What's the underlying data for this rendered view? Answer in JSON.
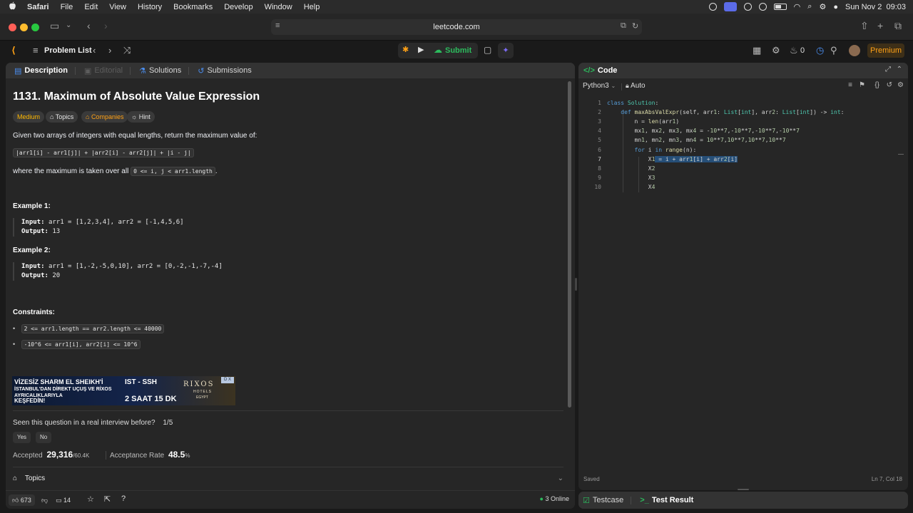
{
  "menubar": {
    "app": "Safari",
    "items": [
      "File",
      "Edit",
      "View",
      "History",
      "Bookmarks",
      "Develop",
      "Window",
      "Help"
    ],
    "datetime": "Sun Nov 2  09:03"
  },
  "safari": {
    "url": "leetcode.com"
  },
  "header": {
    "problem_list": "Problem List",
    "submit": "Submit",
    "streak": "0",
    "premium": "Premium"
  },
  "left_tabs": [
    "Description",
    "Editorial",
    "Solutions",
    "Submissions"
  ],
  "problem": {
    "title": "1131. Maximum of Absolute Value Expression",
    "difficulty": "Medium",
    "chips": [
      "Topics",
      "Companies",
      "Hint"
    ],
    "statement": "Given two arrays of integers with equal lengths, return the maximum value of:",
    "expression": "|arr1[i] - arr1[j]| + |arr2[i] - arr2[j]| + |i - j|",
    "where_text": "where the maximum is taken over all",
    "where_code": "0 <= i, j < arr1.length",
    "where_end": ".",
    "examples": [
      {
        "title": "Example 1:",
        "input_label": "Input:",
        "input": "arr1 = [1,2,3,4], arr2 = [-1,4,5,6]",
        "output_label": "Output:",
        "output": "13"
      },
      {
        "title": "Example 2:",
        "input_label": "Input:",
        "input": "arr1 = [1,-2,-5,0,10], arr2 = [0,-2,-1,-7,-4]",
        "output_label": "Output:",
        "output": "20"
      }
    ],
    "constraints_title": "Constraints:",
    "constraints": [
      "2 <= arr1.length == arr2.length <= 40000",
      "-10^6 <= arr1[i], arr2[i] <= 10^6"
    ]
  },
  "ad": {
    "line1": "VİZESİZ SHARM EL SHEIKH'İ",
    "line2": "İSTANBUL'DAN DİREKT UÇUŞ VE RİXOS AYRICALIKLARIYLA",
    "line3": "KEŞFEDİN!",
    "route": "IST - SSH",
    "duration": "2 SAAT 15 DK",
    "brand": "RIXOS",
    "brand_sub": "HOTELS",
    "brand_loc": "EGYPT",
    "badge": "D X"
  },
  "interview": {
    "question": "Seen this question in a real interview before?",
    "count": "1/5",
    "yes": "Yes",
    "no": "No"
  },
  "stats": {
    "accepted_label": "Accepted",
    "accepted_value": "29,316",
    "accepted_total": "/60.4K",
    "rate_label": "Acceptance Rate",
    "rate_value": "48.5",
    "rate_unit": "%"
  },
  "topics_label": "Topics",
  "footer": {
    "likes": "673",
    "comments": "14",
    "online": "3 Online"
  },
  "code_panel": {
    "title": "Code",
    "language": "Python3",
    "mode": "Auto",
    "lines": [
      "class Solution:",
      "    def maxAbsValExpr(self, arr1: List[int], arr2: List[int]) -> int:",
      "        n = len(arr1)",
      "        mx1, mx2, mx3, mx4 = -10**7,-10**7,-10**7,-10**7",
      "        mn1, mn2, mn3, mn4 = 10**7,10**7,10**7,10**7",
      "        for i in range(n):",
      "            X1 = i + arr1[i] + arr2[i]",
      "            X2",
      "            X3",
      "            X4"
    ],
    "status": "Saved",
    "cursor": "Ln 7, Col 18"
  },
  "bottom_tabs": [
    "Testcase",
    "Test Result"
  ]
}
